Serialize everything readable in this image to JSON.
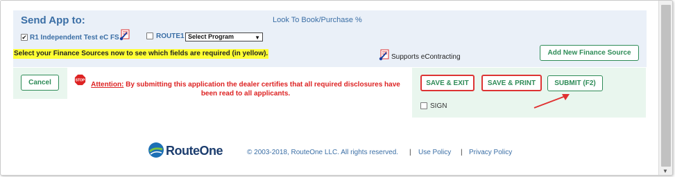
{
  "send_app": {
    "title": "Send App to:",
    "look_link": "Look To Book/Purchase %",
    "finance_sources": [
      {
        "label": "R1 Independent Test eC FS",
        "checked": true
      },
      {
        "label": "ROUTE1",
        "checked": false
      }
    ],
    "program_select": {
      "value": "Select Program"
    },
    "yellow_note": "Select your Finance Sources now to see which fields are required (in yellow).",
    "supports_text": "Supports eContracting",
    "add_button": "Add New Finance Source"
  },
  "cancel_button": "Cancel",
  "attention": {
    "head": "Attention:",
    "text": " By submitting this application the dealer certifies that all required disclosures have been read to all applicants."
  },
  "actions": {
    "save_exit": "SAVE & EXIT",
    "save_print": "SAVE & PRINT",
    "submit": "SUBMIT (F2)",
    "sign_label": "SIGN"
  },
  "footer": {
    "logo_text": "RouteOne",
    "copyright": "© 2003-2018, RouteOne LLC. All rights reserved.",
    "separator": "|",
    "use_policy": "Use Policy",
    "privacy_policy": "Privacy Policy"
  },
  "colors": {
    "accent_blue": "#3a6ea5",
    "green": "#2e8b57",
    "highlight_red": "#dd3333",
    "yellow": "#ffff33"
  }
}
